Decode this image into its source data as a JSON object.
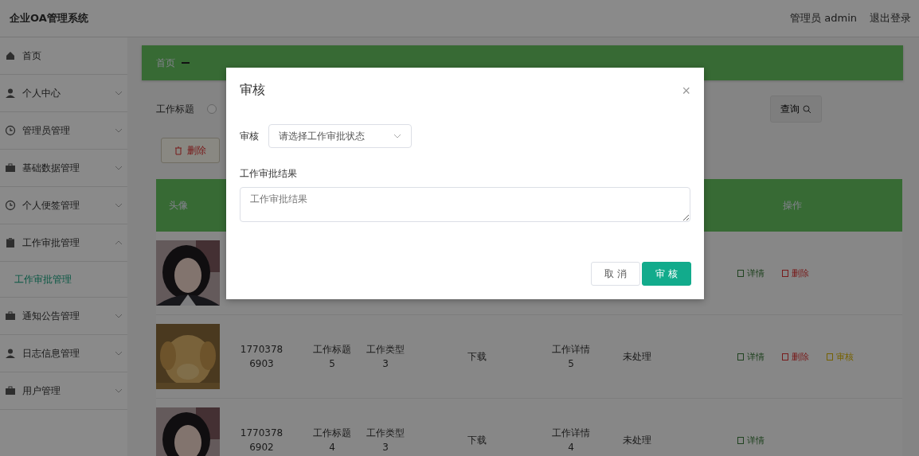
{
  "header": {
    "title": "企业OA管理系统",
    "user": "管理员 admin",
    "logout": "退出登录"
  },
  "sidebar": {
    "items": [
      {
        "label": "首页"
      },
      {
        "label": "个人中心",
        "expanded": false
      },
      {
        "label": "管理员管理",
        "expanded": false
      },
      {
        "label": "基础数据管理",
        "expanded": false
      },
      {
        "label": "个人便签管理",
        "expanded": false
      },
      {
        "label": "工作审批管理",
        "expanded": true,
        "children": [
          {
            "label": "工作审批管理",
            "selected": true
          }
        ]
      },
      {
        "label": "通知公告管理",
        "expanded": false
      },
      {
        "label": "日志信息管理",
        "expanded": false
      },
      {
        "label": "用户管理",
        "expanded": false
      }
    ]
  },
  "breadcrumb": {
    "home": "首页"
  },
  "search": {
    "label": "工作标题",
    "button": "查询"
  },
  "delete_button": "删除",
  "table": {
    "header": {
      "first": "头像",
      "last": "操作"
    },
    "rows": [
      {
        "actions": [
          {
            "label": "详情",
            "kind": "detail"
          },
          {
            "label": "删除",
            "kind": "delete"
          }
        ]
      },
      {
        "cells": [
          "17703786903",
          "工作标题5",
          "工作类型3",
          "下载",
          "工作详情5",
          "未处理"
        ],
        "actions": [
          {
            "label": "详情",
            "kind": "detail"
          },
          {
            "label": "删除",
            "kind": "delete"
          },
          {
            "label": "审核",
            "kind": "review"
          }
        ]
      },
      {
        "cells": [
          "17703786902",
          "工作标题4",
          "工作类型3",
          "下载",
          "工作详情4",
          "未处理"
        ],
        "actions": [
          {
            "label": "详情",
            "kind": "detail"
          }
        ]
      }
    ]
  },
  "dialog": {
    "title": "审核",
    "close": "×",
    "field_label": "审核",
    "select_placeholder": "请选择工作审批状态",
    "result_label": "工作审批结果",
    "result_placeholder": "工作审批结果",
    "cancel": "取 消",
    "confirm": "审 核"
  }
}
